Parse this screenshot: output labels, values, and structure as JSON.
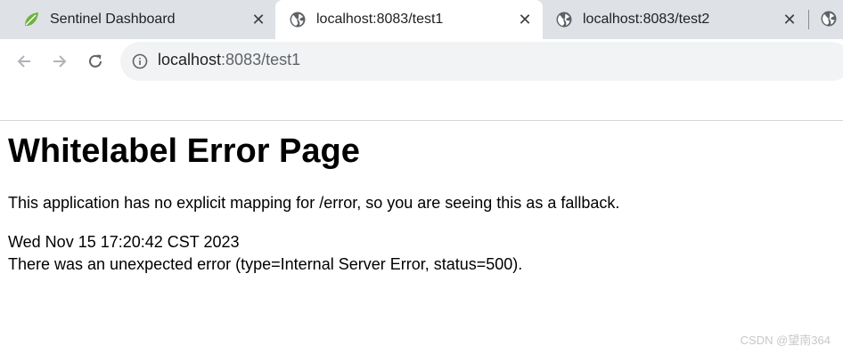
{
  "tabs": [
    {
      "title": "Sentinel Dashboard",
      "icon": "spring-leaf-icon",
      "active": false
    },
    {
      "title": "localhost:8083/test1",
      "icon": "globe-icon",
      "active": true
    },
    {
      "title": "localhost:8083/test2",
      "icon": "globe-icon",
      "active": false
    }
  ],
  "tab_close_glyph": "✕",
  "address": {
    "host": "localhost",
    "port_path": ":8083/test1"
  },
  "page": {
    "heading": "Whitelabel Error Page",
    "description": "This application has no explicit mapping for /error, so you are seeing this as a fallback.",
    "timestamp": "Wed Nov 15 17:20:42 CST 2023",
    "error": "There was an unexpected error (type=Internal Server Error, status=500)."
  },
  "watermark": "CSDN @望南364",
  "colors": {
    "tabstrip": "#dee1e6",
    "omnibox": "#f1f3f4",
    "spring_green": "#6db33f"
  }
}
